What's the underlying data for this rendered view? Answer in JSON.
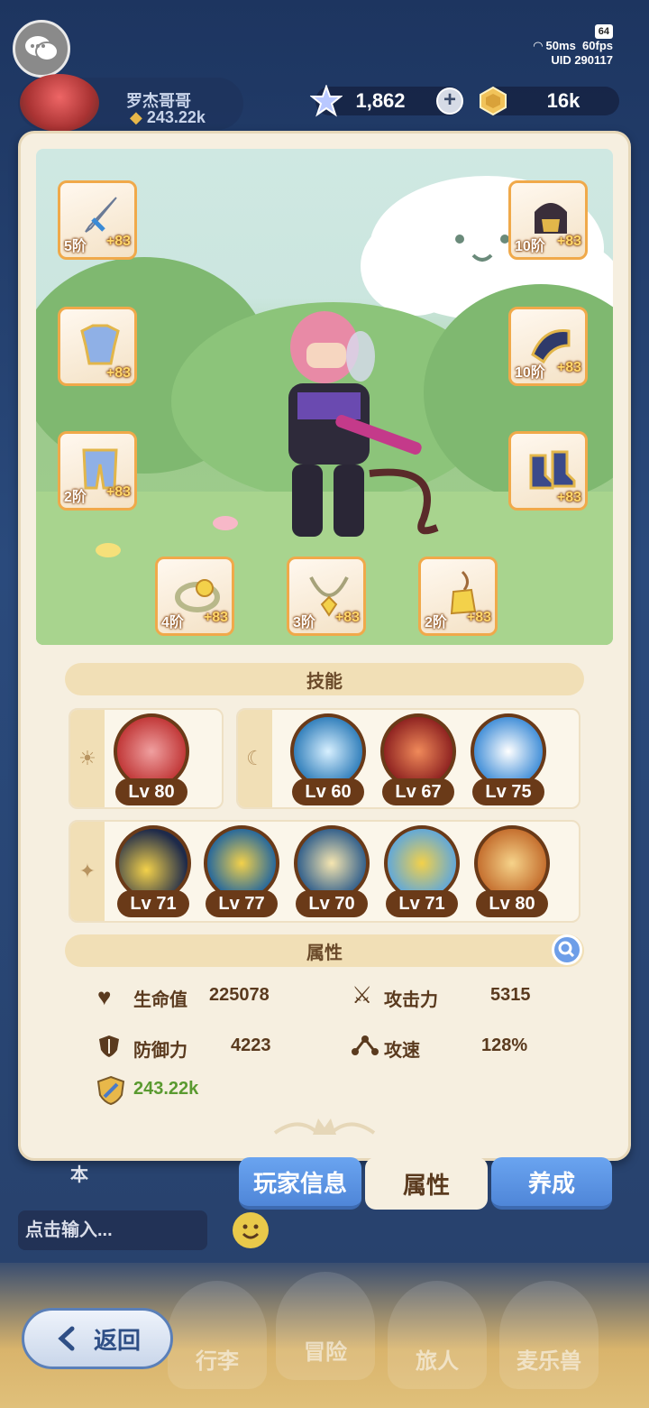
{
  "hud": {
    "battery": "64",
    "ping": "50ms",
    "fps": "60fps",
    "uid": "UID 290117",
    "player_name": "罗杰哥哥",
    "player_power": "243.22k",
    "gems": "1,862",
    "gold": "16k"
  },
  "equipment": [
    {
      "name": "sword",
      "tier": "5阶",
      "level": "+83"
    },
    {
      "name": "helmet",
      "tier": "10阶",
      "level": "+83"
    },
    {
      "name": "armor",
      "tier": "",
      "level": "+83"
    },
    {
      "name": "gauntlet",
      "tier": "10阶",
      "level": "+83"
    },
    {
      "name": "pants",
      "tier": "2阶",
      "level": "+83"
    },
    {
      "name": "boots",
      "tier": "",
      "level": "+83"
    },
    {
      "name": "ring",
      "tier": "4阶",
      "level": "+83"
    },
    {
      "name": "necklace",
      "tier": "3阶",
      "level": "+83"
    },
    {
      "name": "charm",
      "tier": "2阶",
      "level": "+83"
    }
  ],
  "skills": {
    "header": "技能",
    "sun": [
      {
        "lv": "Lv 80"
      }
    ],
    "moon": [
      {
        "lv": "Lv 60"
      },
      {
        "lv": "Lv 67"
      },
      {
        "lv": "Lv 75"
      }
    ],
    "star": [
      {
        "lv": "Lv 71"
      },
      {
        "lv": "Lv 77"
      },
      {
        "lv": "Lv 70"
      },
      {
        "lv": "Lv 71"
      },
      {
        "lv": "Lv 80"
      }
    ]
  },
  "attributes": {
    "header": "属性",
    "hp_label": "生命值",
    "hp_value": "225078",
    "atk_label": "攻击力",
    "atk_value": "5315",
    "def_label": "防御力",
    "def_value": "4223",
    "spd_label": "攻速",
    "spd_value": "128%",
    "power_value": "243.22k"
  },
  "tabs": {
    "player_info": "玩家信息",
    "attributes": "属性",
    "develop": "养成"
  },
  "bottom": {
    "side_char": "本",
    "chat_placeholder": "点击输入...",
    "back": "返回",
    "nav": [
      "行李",
      "冒险",
      "旅人",
      "麦乐兽"
    ]
  },
  "colors": {
    "accent_orange": "#f0a94a",
    "tab_blue": "#4f86d8",
    "panel": "#f6efe0",
    "power_green": "#5a9a30"
  }
}
